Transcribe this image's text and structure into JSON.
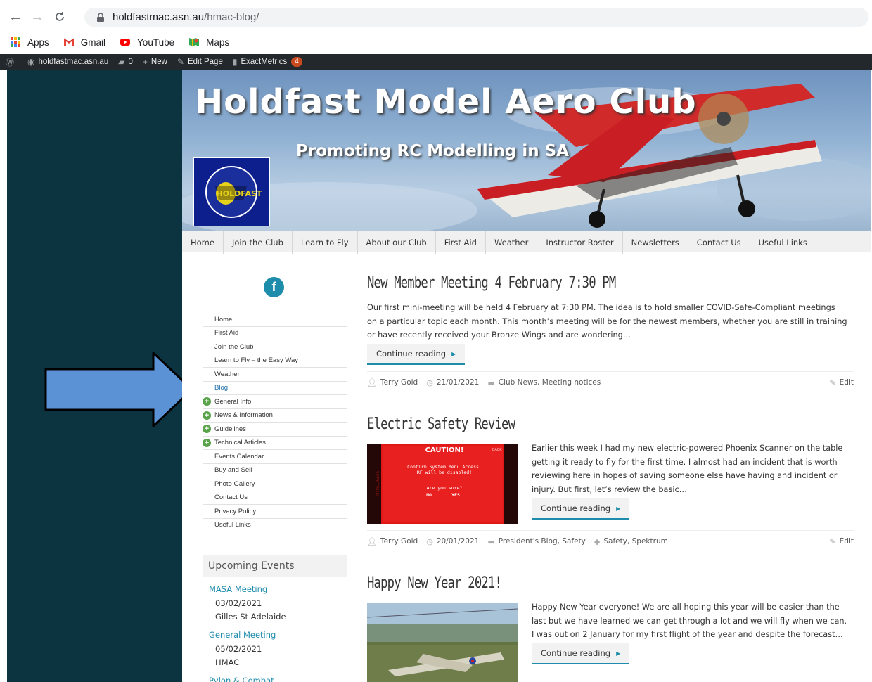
{
  "browser": {
    "back_icon": "arrow-left-icon",
    "forward_icon": "arrow-right-icon",
    "reload_icon": "reload-icon",
    "url_host": "holdfastmac.asn.au",
    "url_path": "/hmac-blog/"
  },
  "bookmarks": [
    {
      "label": "Apps",
      "icon": "apps-grid-icon"
    },
    {
      "label": "Gmail",
      "icon": "gmail-icon"
    },
    {
      "label": "YouTube",
      "icon": "youtube-icon"
    },
    {
      "label": "Maps",
      "icon": "maps-icon"
    }
  ],
  "adminbar": {
    "site": "holdfastmac.asn.au",
    "comments": "0",
    "new": "New",
    "edit_page": "Edit Page",
    "exactmetrics": "ExactMetrics",
    "exactmetrics_count": "4"
  },
  "header": {
    "title": "Holdfast Model Aero Club",
    "tagline": "Promoting RC Modelling in SA",
    "logo_text": "HOLDFAST"
  },
  "nav": [
    "Home",
    "Join the Club",
    "Learn to Fly",
    "About our Club",
    "First Aid",
    "Weather",
    "Instructor Roster",
    "Newsletters",
    "Contact Us",
    "Useful Links"
  ],
  "sidebar": {
    "facebook_glyph": "f",
    "menu": [
      {
        "label": "Home",
        "expandable": false
      },
      {
        "label": "First Aid",
        "expandable": false
      },
      {
        "label": "Join the Club",
        "expandable": false
      },
      {
        "label": "Learn to Fly – the Easy Way",
        "expandable": false
      },
      {
        "label": "Weather",
        "expandable": false
      },
      {
        "label": "Blog",
        "expandable": false,
        "active": true
      },
      {
        "label": "General Info",
        "expandable": true
      },
      {
        "label": "News & Information",
        "expandable": true
      },
      {
        "label": "Guidelines",
        "expandable": true
      },
      {
        "label": "Technical Articles",
        "expandable": true
      },
      {
        "label": "Events Calendar",
        "expandable": false
      },
      {
        "label": "Buy and Sell",
        "expandable": false
      },
      {
        "label": "Photo Gallery",
        "expandable": false
      },
      {
        "label": "Contact Us",
        "expandable": false
      },
      {
        "label": "Privacy Policy",
        "expandable": false
      },
      {
        "label": "Useful Links",
        "expandable": false
      }
    ],
    "events_heading": "Upcoming Events",
    "events": [
      {
        "title": "MASA Meeting",
        "date": "03/02/2021",
        "location": "Gilles St Adelaide"
      },
      {
        "title": "General Meeting",
        "date": "05/02/2021",
        "location": "HMAC"
      },
      {
        "title": "Pylon & Combat",
        "date": "",
        "location": ""
      }
    ]
  },
  "posts": [
    {
      "title": "New Member Meeting 4 February 7:30 PM",
      "excerpt_lines": [
        "Our first mini-meeting will be held 4 February at 7:30 PM. The idea is to hold smaller COVID-Safe-Compliant meetings",
        "on a particular topic each month. This month’s meeting will be for the newest members, whether you are still in training",
        "or have recently received your Bronze Wings and are wondering…"
      ],
      "button": "Continue reading",
      "author": "Terry Gold",
      "date": "21/01/2021",
      "categories": "Club News, Meeting notices",
      "tags": "",
      "edit": "Edit"
    },
    {
      "title": "Electric Safety Review",
      "excerpt_lines": [
        "Earlier this week I had my new electric-powered Phoenix Scanner on the table",
        "getting it ready to fly for the first time. I almost had an incident that is worth",
        "reviewing here in hopes of saving someone else have having and incident or",
        "injury. But first, let’s review the basic…"
      ],
      "button": "Continue reading",
      "author": "Terry Gold",
      "date": "20/01/2021",
      "categories": "President's Blog, Safety",
      "tags": "Safety, Spektrum",
      "edit": "Edit",
      "image_text": {
        "caution": "CAUTION!",
        "back": "BACK",
        "line1": "Confirm System Menu Access.",
        "line2": "RF will be disabled!",
        "line3": "Are you sure?",
        "no": "NO",
        "yes": "YES",
        "brand": "SPEKTRUM"
      }
    },
    {
      "title": "Happy New Year 2021!",
      "excerpt_lines": [
        "Happy New Year everyone!  We are all hoping this year will be easier than the",
        "last but we have learned we can get through a lot and we will fly when we can.",
        "I was out on 2 January for my first flight of the year and despite the forecast…"
      ],
      "button": "Continue reading"
    }
  ],
  "colors": {
    "accent": "#1e8cab",
    "dark_column": "#0b3340",
    "adminbar": "#23282d",
    "arrow_fill": "#5b92d6"
  }
}
